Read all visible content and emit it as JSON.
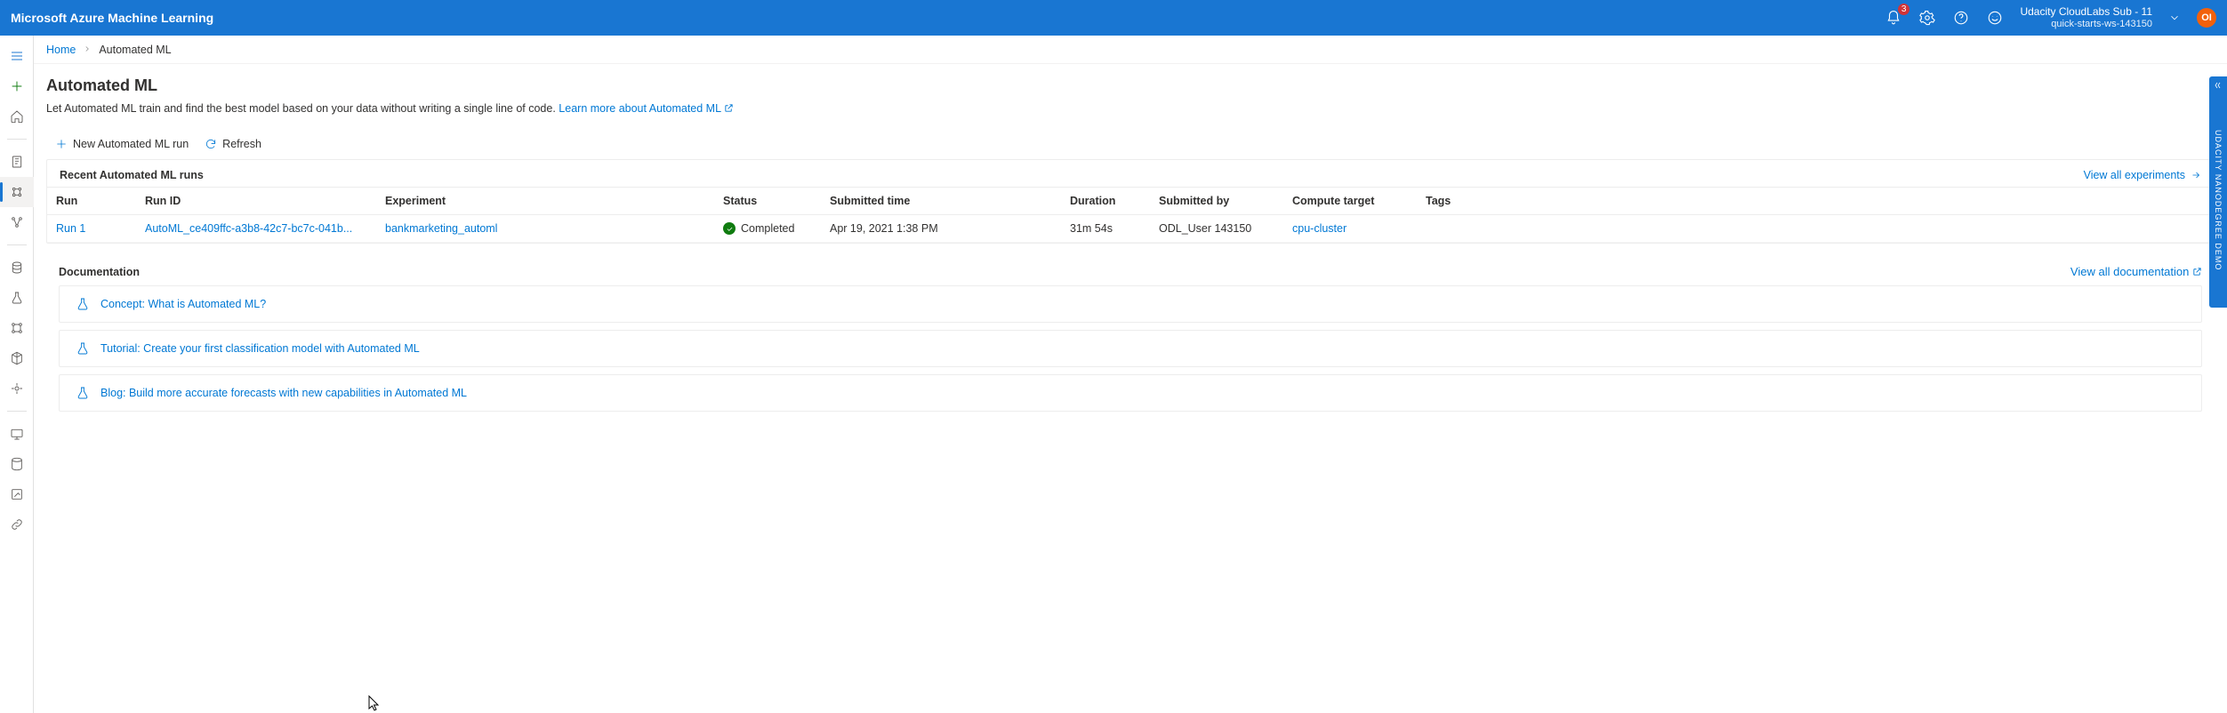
{
  "header": {
    "brand": "Microsoft Azure Machine Learning",
    "notif_count": "3",
    "subscription": "Udacity CloudLabs Sub - 11",
    "workspace": "quick-starts-ws-143150",
    "avatar_initials": "OI"
  },
  "breadcrumb": {
    "home": "Home",
    "current": "Automated ML"
  },
  "page": {
    "title": "Automated ML",
    "description": "Let Automated ML train and find the best model based on your data without writing a single line of code. ",
    "learn_link": "Learn more about Automated ML"
  },
  "commands": {
    "new_run": "New Automated ML run",
    "refresh": "Refresh"
  },
  "runs_section": {
    "title": "Recent Automated ML runs",
    "view_all": "View all experiments",
    "columns": {
      "run": "Run",
      "run_id": "Run ID",
      "experiment": "Experiment",
      "status": "Status",
      "submitted_time": "Submitted time",
      "duration": "Duration",
      "submitted_by": "Submitted by",
      "compute_target": "Compute target",
      "tags": "Tags"
    },
    "rows": [
      {
        "run": "Run 1",
        "run_id": "AutoML_ce409ffc-a3b8-42c7-bc7c-041b...",
        "experiment": "bankmarketing_automl",
        "status": "Completed",
        "submitted_time": "Apr 19, 2021 1:38 PM",
        "duration": "31m 54s",
        "submitted_by": "ODL_User 143150",
        "compute_target": "cpu-cluster",
        "tags": ""
      }
    ]
  },
  "docs_section": {
    "title": "Documentation",
    "view_all": "View all documentation",
    "items": [
      {
        "label": "Concept: What is Automated ML?"
      },
      {
        "label": "Tutorial: Create your first classification model with Automated ML"
      },
      {
        "label": "Blog: Build more accurate forecasts with new capabilities in Automated ML"
      }
    ]
  },
  "ribbon": {
    "text": "UDACITY NANODEGREE DEMO"
  }
}
